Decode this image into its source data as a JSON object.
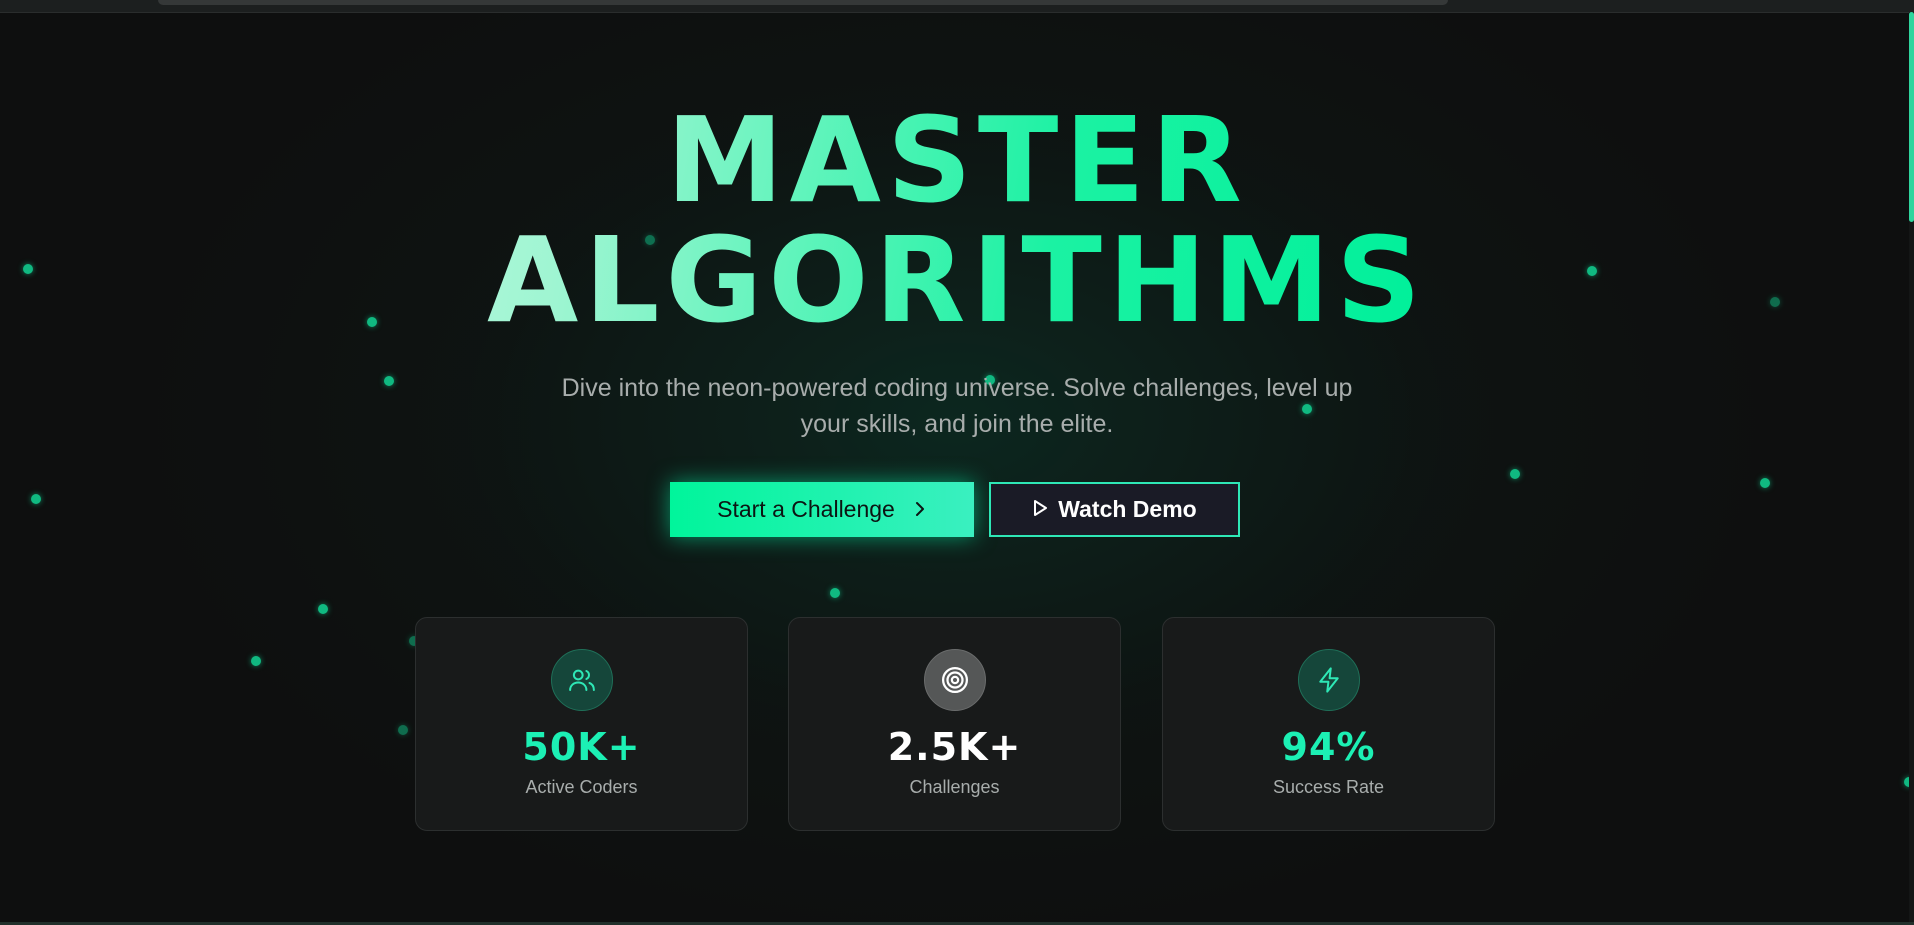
{
  "hero": {
    "title_line1": "MASTER",
    "title_line2": "ALGORITHMS",
    "subtitle": "Dive into the neon-powered coding universe. Solve challenges, level up your skills, and join the elite."
  },
  "actions": {
    "primary_label": "Start a Challenge",
    "primary_icon": "chevron-right-icon",
    "secondary_label": "Watch Demo",
    "secondary_icon": "play-icon"
  },
  "stats": [
    {
      "icon": "users-icon",
      "value": "50K+",
      "label": "Active Coders"
    },
    {
      "icon": "target-icon",
      "value": "2.5K+",
      "label": "Challenges"
    },
    {
      "icon": "lightning-icon",
      "value": "94%",
      "label": "Success Rate"
    }
  ],
  "colors": {
    "accent": "#1cf0b4",
    "accent_gradient_start": "#00f59b",
    "accent_gradient_end": "#3af0c0",
    "background": "#0e0f0f",
    "card_background": "#181a1a",
    "secondary_button_background": "#1a1b26",
    "particle": "#10b981"
  }
}
